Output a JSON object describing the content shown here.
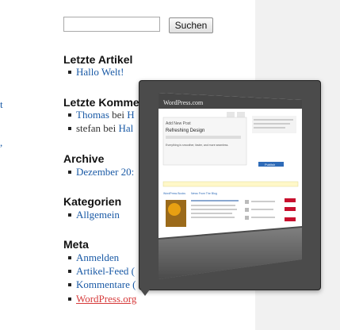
{
  "search": {
    "button_label": "Suchen",
    "value": ""
  },
  "left_fragments": [
    "t",
    ","
  ],
  "sections": {
    "recent_posts": {
      "title": "Letzte Artikel",
      "items": [
        "Hallo Welt!"
      ]
    },
    "recent_comments": {
      "title": "Letzte Komme",
      "items": [
        {
          "author": "Thomas",
          "connector": " bei ",
          "post": "H"
        },
        {
          "author": "stefan",
          "connector": " bei ",
          "post": "Hal"
        }
      ]
    },
    "archive": {
      "title": "Archive",
      "items": [
        "Dezember 20:"
      ]
    },
    "categories": {
      "title": "Kategorien",
      "items": [
        "Allgemein"
      ]
    },
    "meta": {
      "title": "Meta",
      "items": [
        "Anmelden",
        "Artikel-Feed (",
        "Kommentare (",
        "WordPress.org"
      ]
    }
  },
  "preview": {
    "site_name": "WordPress.com",
    "editor_heading": "Add New Post",
    "post_title": "Refreshing Design",
    "body_text": "Everything is smoother, faster, and more seamless.",
    "publish_label": "Publish",
    "book_title": "WordPress Books",
    "news_title": "News From The Blog",
    "colors": {
      "frame": "#4b4b4b",
      "link": "#1a5aa6",
      "link_hover": "#d63a3a"
    }
  }
}
